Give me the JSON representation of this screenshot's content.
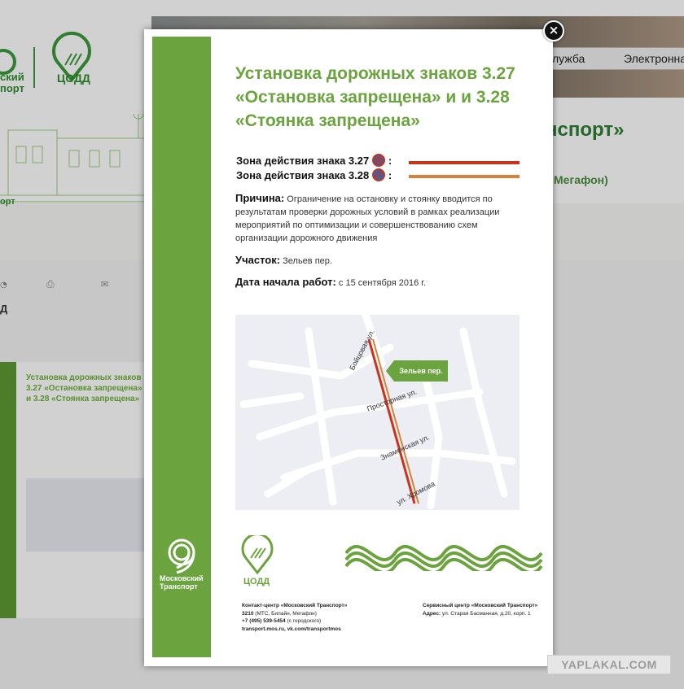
{
  "background": {
    "nav": {
      "item1": "лужба",
      "item2": "Электронна"
    },
    "title_fragment": "нспорт»",
    "subtitle_fragment": "Мегафон)",
    "codd_logo_text": "ЦОДД",
    "left_logo_text_1": "ский",
    "left_logo_text_2": "порт",
    "left_fragment_1": "орт",
    "left_fragment_2": "Д",
    "flyer_title": "Установка дорожных знаков 3.27 «Остановка запрещена» и 3.28 «Стоянка запрещена»"
  },
  "modal": {
    "close_label": "×",
    "title": "Установка дорожных знаков 3.27 «Остановка запрещена» и и 3.28 «Стоянка запрещена»",
    "zone_327": "Зона действия знака 3.27",
    "zone_328": "Зона действия знака 3.28",
    "colon": ":",
    "reason_label": "Причина:",
    "reason_text": "Ограничение на остановку и стоянку вводится по результатам проверки дорожных условий в рамках реализации мероприятий по оптимизации и совершенствованию схем организации дорожного движения",
    "section_label": "Участок:",
    "section_text": "Зельев пер.",
    "start_label": "Дата начала работ:",
    "start_text": "с 15 сентября 2016 г.",
    "map": {
      "callout": "Зельев пер.",
      "street_1": "Бойцовая ул.",
      "street_2": "Просторная ул.",
      "street_3": "Знаменская ул.",
      "street_4": "ул. Хромова"
    },
    "brand_name": "Московский Транспорт",
    "codd_text": "ЦОДД",
    "contact_1": {
      "title": "Контакт-центр «Московский Транспорт»",
      "line1_bold": "3210",
      "line1_rest": "(МТС, Билайн, Мегафон)",
      "line2_bold": "+7 (495) 539-5454",
      "line2_rest": "(с городского)",
      "line3": "transport.mos.ru, vk.com/transportmos"
    },
    "contact_2": {
      "title": "Сервисный центр «Московский Транспорт»",
      "line1_bold": "Адрес:",
      "line1_rest": "ул. Старая Басманная, д.20, корп. 1"
    },
    "colors": {
      "green": "#6ba43e",
      "red_line": "#c8341b",
      "orange_line": "#d9813a"
    }
  },
  "watermark": "YAPLAKAL.COM"
}
